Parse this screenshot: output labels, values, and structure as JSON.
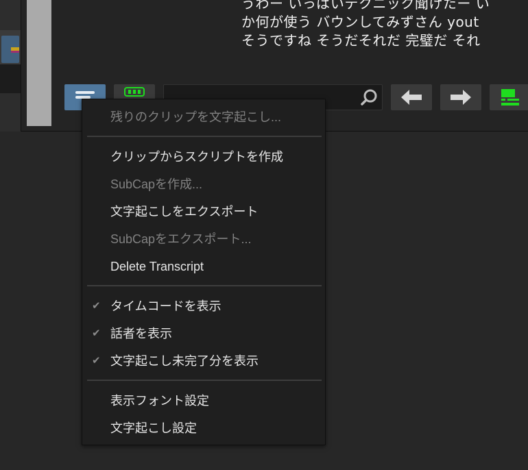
{
  "transcript_lines": [
    "うわー いっぱいテクニック聞けたー い",
    "か何が使う バウンしてみずさん yout",
    "そうですね そうだそれだ 完璧だ それ"
  ],
  "search": {
    "value": "",
    "placeholder": ""
  },
  "context_menu": {
    "items": [
      {
        "label": "残りのクリップを文字起こし...",
        "enabled": false,
        "checked": false
      },
      {
        "label": "クリップからスクリプトを作成",
        "enabled": true,
        "checked": false
      },
      {
        "label": "SubCapを作成...",
        "enabled": false,
        "checked": false
      },
      {
        "label": "文字起こしをエクスポート",
        "enabled": true,
        "checked": false
      },
      {
        "label": "SubCapをエクスポート...",
        "enabled": false,
        "checked": false
      },
      {
        "label": "Delete Transcript",
        "enabled": true,
        "checked": false
      },
      {
        "label": "タイムコードを表示",
        "enabled": true,
        "checked": true
      },
      {
        "label": "話者を表示",
        "enabled": true,
        "checked": true
      },
      {
        "label": "文字起こし未完了分を表示",
        "enabled": true,
        "checked": true
      },
      {
        "label": "表示フォント設定",
        "enabled": true,
        "checked": false
      },
      {
        "label": "文字起こし設定",
        "enabled": true,
        "checked": false
      }
    ],
    "check_glyph": "✔"
  },
  "colors": {
    "menu_bg": "#1f1f1f",
    "menu_text": "#e6e6e6",
    "menu_text_disabled": "#828282",
    "accent_button": "#4f789e",
    "green_icon": "#1fdc1f"
  },
  "icons": {
    "menu_button": "hamburger-icon",
    "green_button": "caption-icon",
    "search": "search-icon",
    "prev": "arrow-left-icon",
    "next": "arrow-right-icon",
    "view": "layout-icon"
  }
}
